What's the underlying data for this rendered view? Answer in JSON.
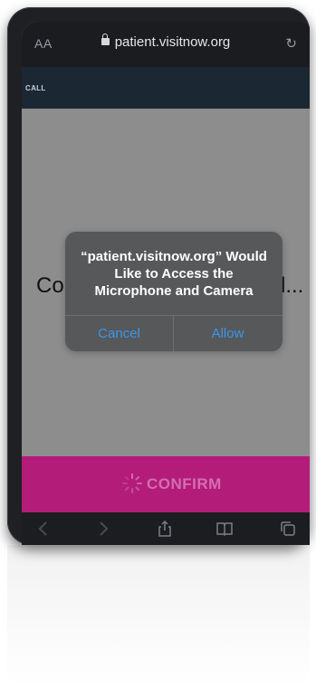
{
  "browser": {
    "text_size_label": "AA",
    "url": "patient.visitnow.org"
  },
  "page": {
    "call_label": "CALL",
    "background_title_start": "Co",
    "background_title_end": "l...",
    "confirm_label": "CONFIRM",
    "confirm_color": "#b41c7a"
  },
  "dialog": {
    "message": "“patient.visitnow.org” Would Like to Access the Microphone and Camera",
    "cancel_label": "Cancel",
    "allow_label": "Allow",
    "button_color": "#3b96ee"
  },
  "toolbar": {
    "icons": [
      "back-icon",
      "forward-icon",
      "share-icon",
      "bookmarks-icon",
      "tabs-icon"
    ]
  }
}
